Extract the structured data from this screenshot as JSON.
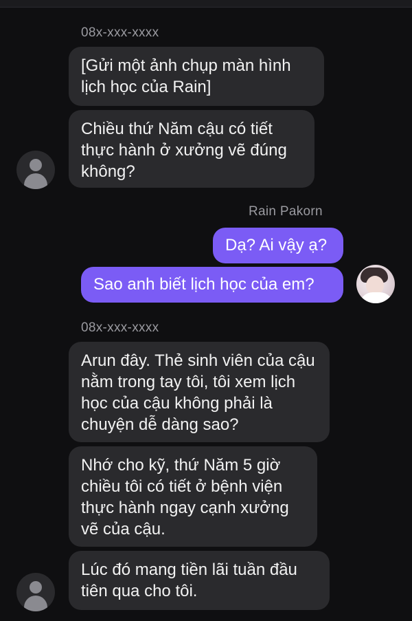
{
  "contacts": {
    "unknown_number": "08x-xxx-xxxx",
    "self_name": "Rain Pakorn"
  },
  "messages": [
    {
      "text": "[Gửi một ảnh chụp màn hình lịch học của Rain]"
    },
    {
      "text": "Chiều thứ Năm cậu có tiết thực hành ở xưởng vẽ đúng không?"
    },
    {
      "text": "Dạ? Ai vậy ạ?"
    },
    {
      "text": "Sao anh biết lịch học của em?"
    },
    {
      "text": "Arun đây. Thẻ sinh viên của cậu nằm trong tay tôi, tôi xem lịch học của cậu không phải là chuyện dễ dàng sao?"
    },
    {
      "text": "Nhớ cho kỹ, thứ Năm 5 giờ chiều tôi có tiết ở bệnh viện thực hành ngay cạnh xưởng vẽ của cậu."
    },
    {
      "text": "Lúc đó mang tiền lãi tuần đầu tiên qua cho tôi."
    }
  ],
  "colors": {
    "background": "#0f0f11",
    "received_bubble": "#2a2a2d",
    "sent_bubble": "#7b5cf5"
  }
}
